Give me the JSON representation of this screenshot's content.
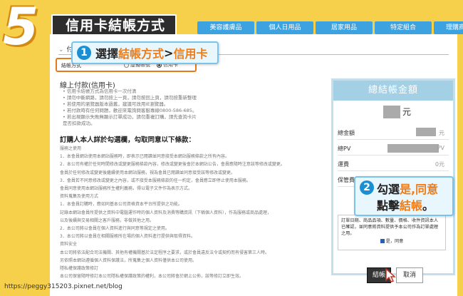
{
  "step": {
    "number": "5",
    "title": "信用卡結帳方式"
  },
  "nav": [
    "美容護膚品",
    "個人日用品",
    "居家用品",
    "特定組合",
    "理購商品"
  ],
  "payment": {
    "section_title": "付款資訊",
    "row_label": "結帳方式",
    "options": [
      {
        "label": "虛擬帳號",
        "selected": false
      },
      {
        "label": "信用卡",
        "selected": true
      }
    ]
  },
  "card_info": {
    "title": "線上付款(信用卡)",
    "lines": [
      "• 信用卡結帳方式為信用卡一次付清",
      "• 請勿中斷網路，請勿按上一頁，請勿按回上頁，請勿按重新整理",
      "• 若使用的瀏覽器版本過舊，建議可改用IE瀏覽器。",
      "• 若付款時有任何問題，歡迎來電詢問客服專線0800-586-685。",
      "• 若出現顯示失敗無顯示訂單成功，請勿重複訂購，請先查詢卡片是否扣款成功。"
    ]
  },
  "callout1": {
    "num": "1",
    "prefix": "選擇",
    "highlight": "結帳方式",
    "sep": ">",
    "highlight2": "信用卡"
  },
  "terms": {
    "title": "訂購人本人詳於勾選欄，勾取同意以下條款：",
    "paragraphs": [
      "服務之使用",
      "1．本會員網站使用本網站服務時，即表示已閱讀並同意接受本網站服務條款之所有內容。",
      "2．本公司有權於任何時間修改或變更服務條款內容，修改或變更後會於本網站公告，會員應隨時注意該等修改或變更。",
      "會員於任何修改或變更後繼續使用本網站服務，視為會員已閱讀並同意接受該等修改或變更。",
      "3．會員若不同意修改或變更之內容，或不接受本服務條款的任一約定，會員應立即停止使用本服務。",
      "會員同意使用本網站服務所生權利義務，得以電子文件作為表示方式。",
      "資料蒐集及使用方式",
      "1．本會員訂購時，應如同基本公司資格資本平台所提供之功能。",
      "記錄本網站會員所提供之資料中電腦運作時的個人資料及消費等購資訊（下稱個人資料），作為服務或商品處理，",
      "以及後續與交易相關之客戶服務，非做其他之用。",
      "2．本公司將以會員在個人資料進行與同意等規定之使用。",
      "3．本公司將以會員在相關服務所在場的個人資料進行提供與取得資料。",
      "資料安全",
      "本公司將依法配合司法機關、其他有權機關基於法定程序之要求，或於會員違反法令或契約而有侵害第三人時。",
      "另依照本網站遵循個人資料保護法，所蒐集之個人資料僅供本公司使用。",
      "隱私權保護政策修訂",
      "本公司保留隨時修訂本公司隱私權保護政策的權利，本公司將會於網上公佈，該等修訂立即生效。"
    ]
  },
  "summary": {
    "title": "總結帳金額",
    "amount_unit": "元",
    "rows": [
      {
        "label": "總金額",
        "value": "元"
      },
      {
        "label": "總PV",
        "value": "PV"
      },
      {
        "label": "運費",
        "value": "0元"
      },
      {
        "label": "保管費",
        "value": ""
      }
    ],
    "agreement_text": "訂單日期、商品品項、數量、價格、收件資訊本人已確認，並同意將資料提供予本公司作為訂單處理之用。",
    "agree_label": "是，同意"
  },
  "callout2": {
    "num": "2",
    "line1_prefix": "勾選",
    "line1_highlight": "是,同意",
    "line2_prefix": "點擊",
    "line2_highlight": "結帳",
    "line2_suffix": "。"
  },
  "buttons": {
    "checkout": "結帳",
    "cancel": "取消"
  },
  "url": "https://peggy315203.pixnet.net/blog"
}
